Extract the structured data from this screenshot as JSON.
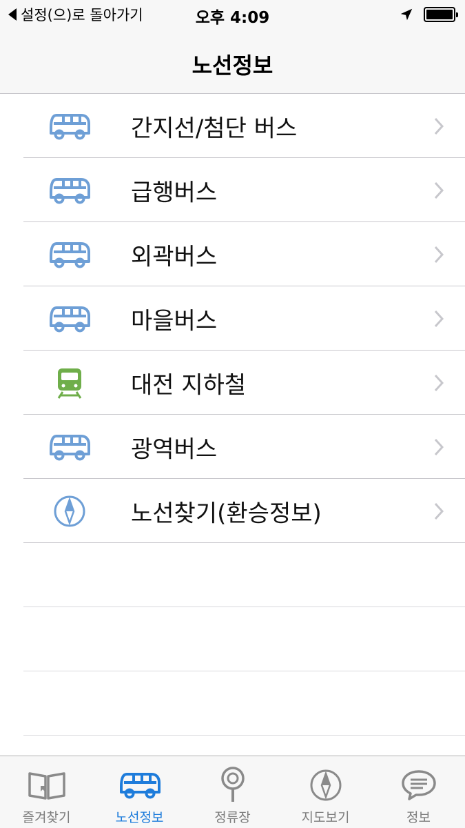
{
  "status_bar": {
    "back_label": "설정(으)로 돌아가기",
    "time": "오후 4:09",
    "battery_level": 1.0
  },
  "nav": {
    "title": "노선정보"
  },
  "rows": [
    {
      "label": "간지선/첨단 버스",
      "icon": "bus-icon"
    },
    {
      "label": "급행버스",
      "icon": "bus-icon"
    },
    {
      "label": "외곽버스",
      "icon": "bus-icon"
    },
    {
      "label": "마을버스",
      "icon": "bus-icon"
    },
    {
      "label": "대전 지하철",
      "icon": "subway-train-icon"
    },
    {
      "label": "광역버스",
      "icon": "bus-icon"
    },
    {
      "label": "노선찾기(환승정보)",
      "icon": "compass-icon"
    }
  ],
  "tabs": [
    {
      "label": "즐겨찾기",
      "icon": "open-book-icon",
      "active": false
    },
    {
      "label": "노선정보",
      "icon": "bus-icon",
      "active": true
    },
    {
      "label": "정류장",
      "icon": "bus-stop-icon",
      "active": false
    },
    {
      "label": "지도보기",
      "icon": "compass-icon",
      "active": false
    },
    {
      "label": "정보",
      "icon": "speech-bubble-icon",
      "active": false
    }
  ],
  "colors": {
    "bus_icon": "#6e9fd6",
    "subway_icon": "#6fae4a",
    "tab_active": "#1e7cdb",
    "tab_inactive": "#8a8a8a",
    "chevron": "#c7c7cc"
  }
}
